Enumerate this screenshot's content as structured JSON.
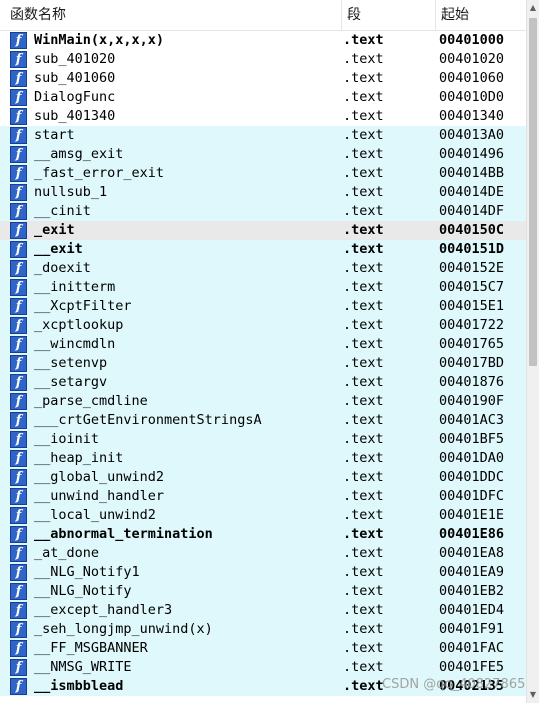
{
  "header": {
    "col_name": "函数名称",
    "col_segment": "段",
    "col_start": "起始"
  },
  "functions": [
    {
      "name": "WinMain(x,x,x,x)",
      "segment": ".text",
      "start": "00401000",
      "bold": true,
      "hl": false,
      "sel": false
    },
    {
      "name": "sub_401020",
      "segment": ".text",
      "start": "00401020",
      "bold": false,
      "hl": false,
      "sel": false
    },
    {
      "name": "sub_401060",
      "segment": ".text",
      "start": "00401060",
      "bold": false,
      "hl": false,
      "sel": false
    },
    {
      "name": "DialogFunc",
      "segment": ".text",
      "start": "004010D0",
      "bold": false,
      "hl": false,
      "sel": false
    },
    {
      "name": "sub_401340",
      "segment": ".text",
      "start": "00401340",
      "bold": false,
      "hl": false,
      "sel": false
    },
    {
      "name": "start",
      "segment": ".text",
      "start": "004013A0",
      "bold": false,
      "hl": true,
      "sel": false
    },
    {
      "name": "__amsg_exit",
      "segment": ".text",
      "start": "00401496",
      "bold": false,
      "hl": true,
      "sel": false
    },
    {
      "name": "_fast_error_exit",
      "segment": ".text",
      "start": "004014BB",
      "bold": false,
      "hl": true,
      "sel": false
    },
    {
      "name": "nullsub_1",
      "segment": ".text",
      "start": "004014DE",
      "bold": false,
      "hl": true,
      "sel": false
    },
    {
      "name": "__cinit",
      "segment": ".text",
      "start": "004014DF",
      "bold": false,
      "hl": true,
      "sel": false
    },
    {
      "name": "_exit",
      "segment": ".text",
      "start": "0040150C",
      "bold": true,
      "hl": false,
      "sel": true
    },
    {
      "name": "__exit",
      "segment": ".text",
      "start": "0040151D",
      "bold": true,
      "hl": true,
      "sel": false
    },
    {
      "name": "_doexit",
      "segment": ".text",
      "start": "0040152E",
      "bold": false,
      "hl": true,
      "sel": false
    },
    {
      "name": "__initterm",
      "segment": ".text",
      "start": "004015C7",
      "bold": false,
      "hl": true,
      "sel": false
    },
    {
      "name": "__XcptFilter",
      "segment": ".text",
      "start": "004015E1",
      "bold": false,
      "hl": true,
      "sel": false
    },
    {
      "name": "_xcptlookup",
      "segment": ".text",
      "start": "00401722",
      "bold": false,
      "hl": true,
      "sel": false
    },
    {
      "name": "__wincmdln",
      "segment": ".text",
      "start": "00401765",
      "bold": false,
      "hl": true,
      "sel": false
    },
    {
      "name": "__setenvp",
      "segment": ".text",
      "start": "004017BD",
      "bold": false,
      "hl": true,
      "sel": false
    },
    {
      "name": "__setargv",
      "segment": ".text",
      "start": "00401876",
      "bold": false,
      "hl": true,
      "sel": false
    },
    {
      "name": "_parse_cmdline",
      "segment": ".text",
      "start": "0040190F",
      "bold": false,
      "hl": true,
      "sel": false
    },
    {
      "name": "___crtGetEnvironmentStringsA",
      "segment": ".text",
      "start": "00401AC3",
      "bold": false,
      "hl": true,
      "sel": false
    },
    {
      "name": "__ioinit",
      "segment": ".text",
      "start": "00401BF5",
      "bold": false,
      "hl": true,
      "sel": false
    },
    {
      "name": "__heap_init",
      "segment": ".text",
      "start": "00401DA0",
      "bold": false,
      "hl": true,
      "sel": false
    },
    {
      "name": "__global_unwind2",
      "segment": ".text",
      "start": "00401DDC",
      "bold": false,
      "hl": true,
      "sel": false
    },
    {
      "name": "__unwind_handler",
      "segment": ".text",
      "start": "00401DFC",
      "bold": false,
      "hl": true,
      "sel": false
    },
    {
      "name": "__local_unwind2",
      "segment": ".text",
      "start": "00401E1E",
      "bold": false,
      "hl": true,
      "sel": false
    },
    {
      "name": "__abnormal_termination",
      "segment": ".text",
      "start": "00401E86",
      "bold": true,
      "hl": true,
      "sel": false
    },
    {
      "name": "_at_done",
      "segment": ".text",
      "start": "00401EA8",
      "bold": false,
      "hl": true,
      "sel": false
    },
    {
      "name": "__NLG_Notify1",
      "segment": ".text",
      "start": "00401EA9",
      "bold": false,
      "hl": true,
      "sel": false
    },
    {
      "name": "__NLG_Notify",
      "segment": ".text",
      "start": "00401EB2",
      "bold": false,
      "hl": true,
      "sel": false
    },
    {
      "name": "__except_handler3",
      "segment": ".text",
      "start": "00401ED4",
      "bold": false,
      "hl": true,
      "sel": false
    },
    {
      "name": "_seh_longjmp_unwind(x)",
      "segment": ".text",
      "start": "00401F91",
      "bold": false,
      "hl": true,
      "sel": false
    },
    {
      "name": "__FF_MSGBANNER",
      "segment": ".text",
      "start": "00401FAC",
      "bold": false,
      "hl": true,
      "sel": false
    },
    {
      "name": "__NMSG_WRITE",
      "segment": ".text",
      "start": "00401FE5",
      "bold": false,
      "hl": true,
      "sel": false
    },
    {
      "name": "__ismbblead",
      "segment": ".text",
      "start": "00402135",
      "bold": true,
      "hl": true,
      "sel": false
    }
  ],
  "icon_glyph": "f",
  "watermark": "CSDN @qq_40827865",
  "colors": {
    "row_highlight": "#dff8fb",
    "row_selected": "#e9e9e9",
    "icon_bg": "#2f64c8"
  }
}
